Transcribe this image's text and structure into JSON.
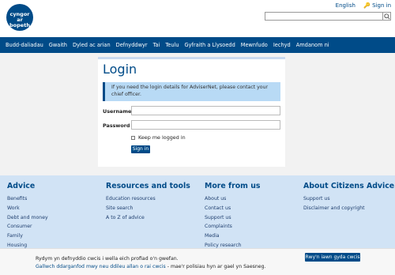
{
  "brand": {
    "logo_line1": "cyngor ar",
    "logo_line2": "bopeth"
  },
  "top_links": {
    "language": "English",
    "sign_in": "Sign in"
  },
  "search": {
    "placeholder": ""
  },
  "nav": [
    "Budd-daliadau",
    "Gwaith",
    "Dyled ac arian",
    "Defnyddwyr",
    "Tai",
    "Teulu",
    "Gyfraith a Llysoedd",
    "Mewnfudo",
    "Iechyd",
    "Amdanom ni"
  ],
  "login": {
    "title": "Login",
    "info": "If you need the login details for AdviserNet, please contact your chief officer.",
    "username_label": "Username",
    "password_label": "Password",
    "keep_logged_in": "Keep me logged in",
    "sign_in_button": "Sign in"
  },
  "footer": [
    {
      "heading": "Advice",
      "links": [
        "Benefits",
        "Work",
        "Debt and money",
        "Consumer",
        "Family",
        "Housing"
      ]
    },
    {
      "heading": "Resources and tools",
      "links": [
        "Education resources",
        "Site search",
        "A to Z of advice"
      ]
    },
    {
      "heading": "More from us",
      "links": [
        "About us",
        "Contact us",
        "Support us",
        "Complaints",
        "Media",
        "Policy research"
      ]
    },
    {
      "heading": "About Citizens Advice",
      "links": [
        "Support us",
        "Disclaimer and copyright"
      ]
    }
  ],
  "cookie": {
    "line1": "Rydym yn defnyddio cwcis i wella eich profiad o'n gwefan.",
    "link": "Gallwch ddarganfod mwy neu ddileu allan o rai cwcis",
    "line2_rest": " - mae'r polisiau hyn ar gael yn Saesneg.",
    "button": "Rwy'n iawn gyda cwcis"
  },
  "colors": {
    "primary": "#004b88",
    "footer_bg": "#d1e3f5",
    "info_bg": "#b8daf5"
  }
}
